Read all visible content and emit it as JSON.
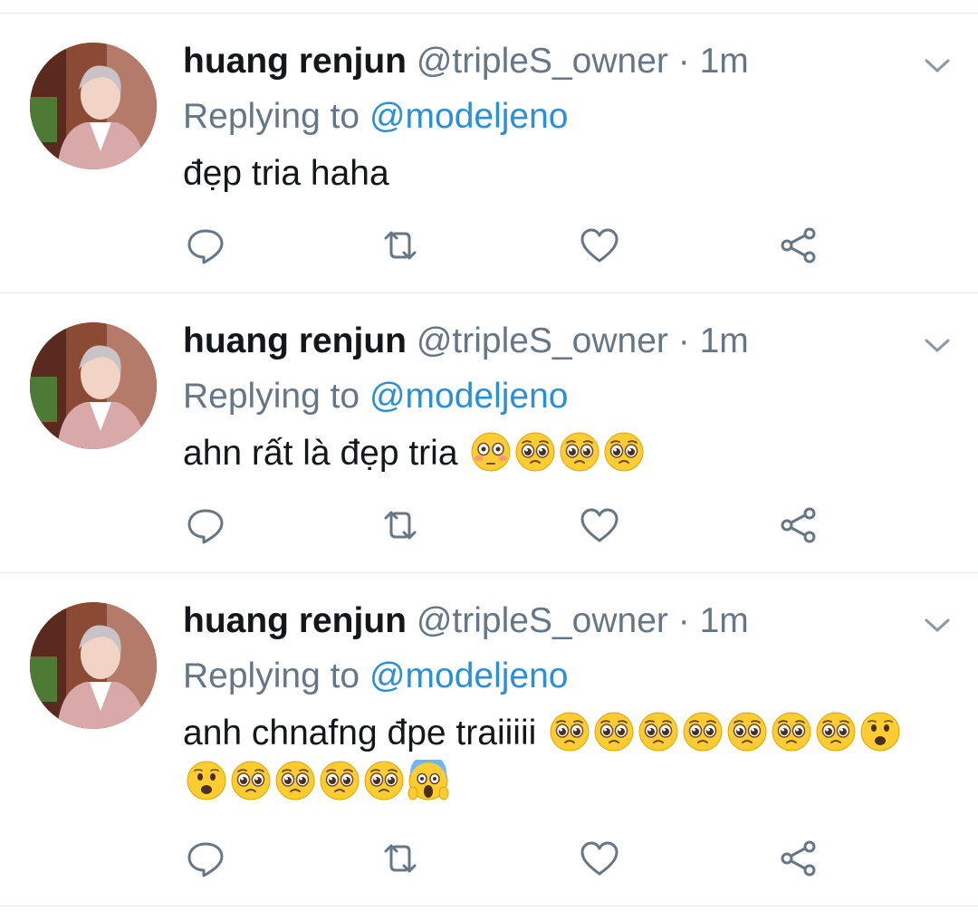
{
  "tweets": [
    {
      "name": "huang renjun",
      "handle": "@tripleS_owner",
      "separator": "·",
      "time": "1m",
      "replying_prefix": "Replying to ",
      "replying_to": "@modeljeno",
      "text": "đẹp tria haha",
      "emojis": []
    },
    {
      "name": "huang renjun",
      "handle": "@tripleS_owner",
      "separator": "·",
      "time": "1m",
      "replying_prefix": "Replying to ",
      "replying_to": "@modeljeno",
      "text": "ahn rất là đẹp tria",
      "emojis": [
        "flushed-face",
        "pleading-face",
        "pleading-face",
        "pleading-face"
      ]
    },
    {
      "name": "huang renjun",
      "handle": "@tripleS_owner",
      "separator": "·",
      "time": "1m",
      "replying_prefix": "Replying to ",
      "replying_to": "@modeljeno",
      "text": "anh chnafng đpe traiiiii",
      "emojis": [
        "pleading-face",
        "pleading-face",
        "pleading-face",
        "pleading-face",
        "pleading-face",
        "pleading-face",
        "pleading-face",
        "frowning-open-mouth-face",
        "frowning-open-mouth-face",
        "pleading-face",
        "pleading-face",
        "pleading-face",
        "pleading-face",
        "screaming-face"
      ]
    }
  ],
  "action_icons": [
    "reply-icon",
    "retweet-icon",
    "like-icon",
    "share-icon"
  ],
  "colors": {
    "mention": "#2b8fd6",
    "secondary_text": "#657786",
    "divider": "#e1e8ed",
    "emoji_yellow": "#ffcc33"
  }
}
